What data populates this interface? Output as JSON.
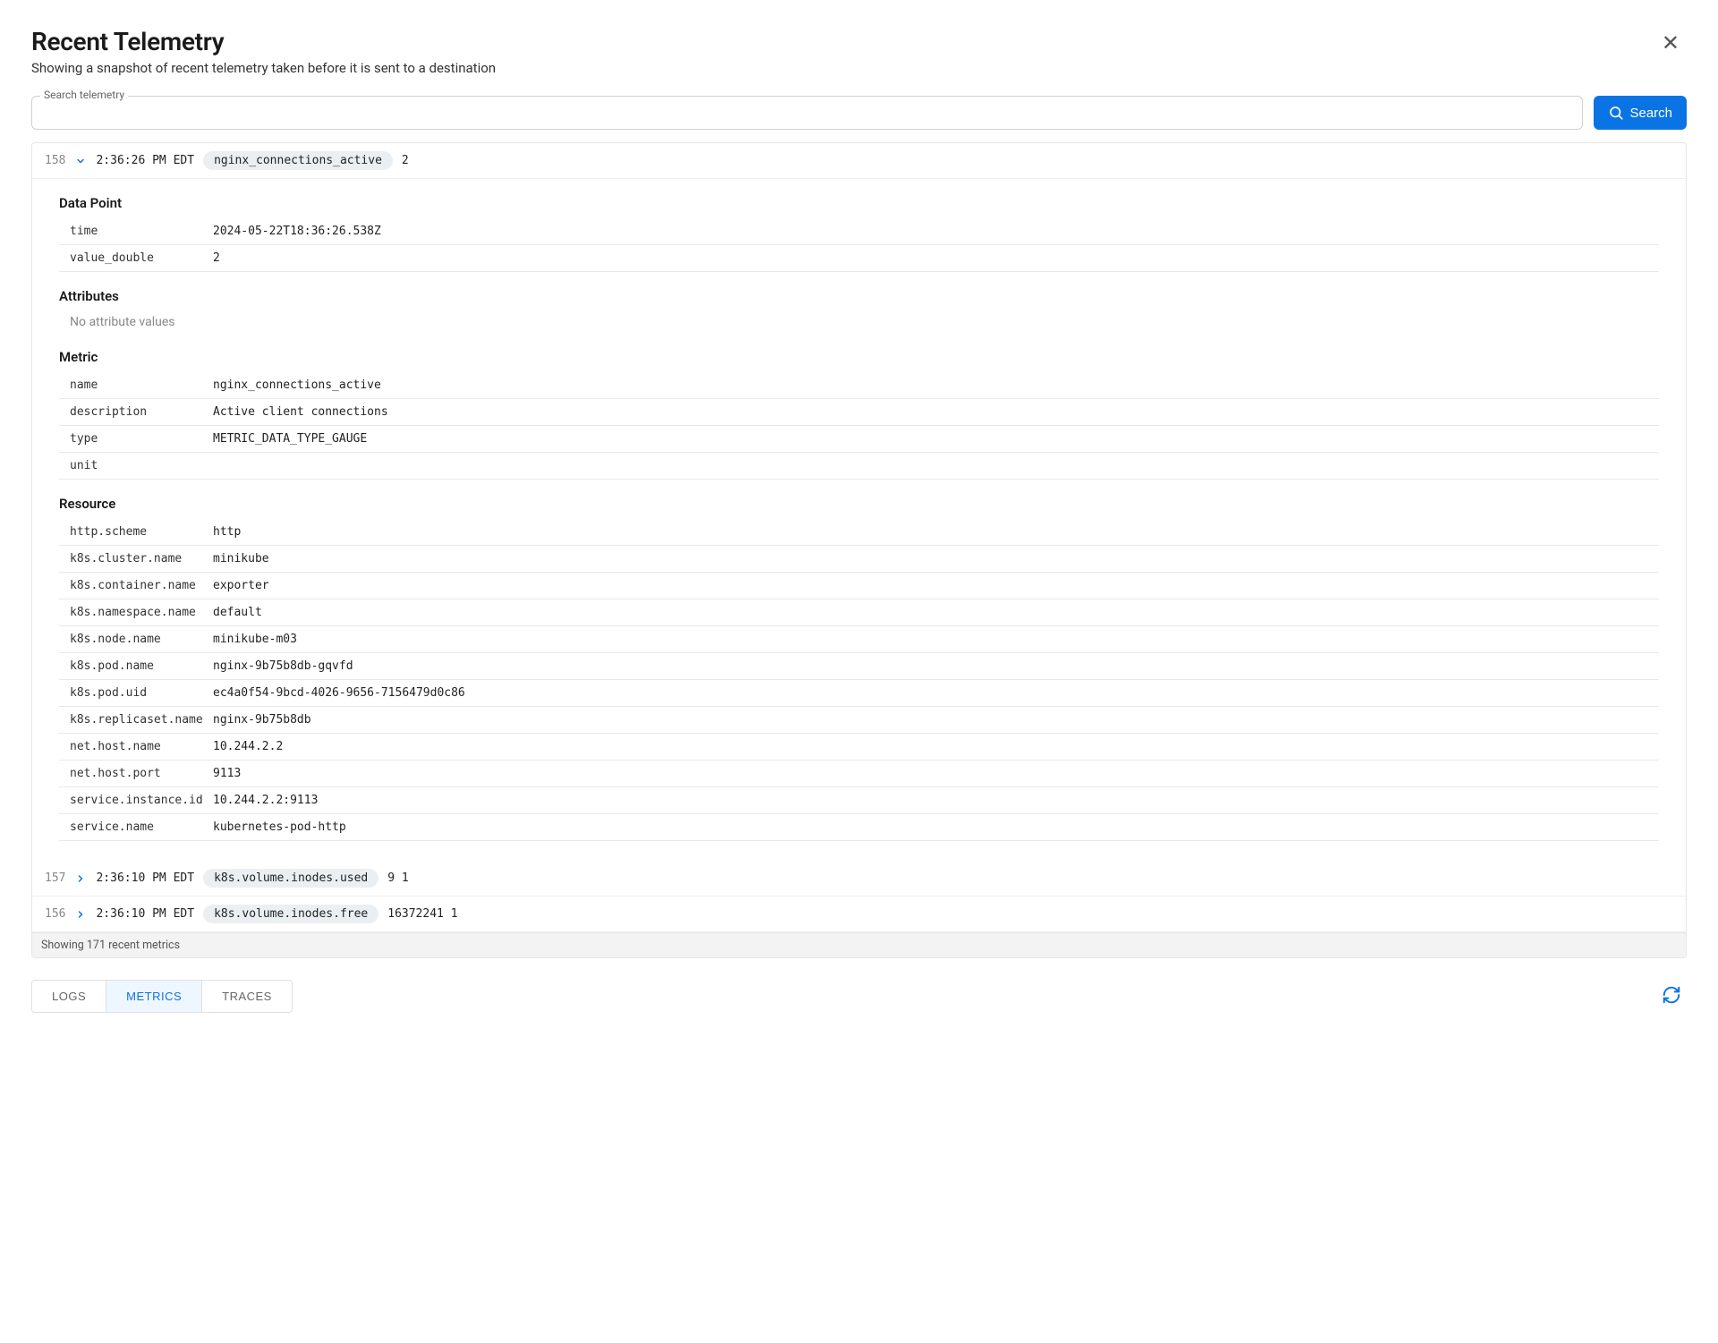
{
  "header": {
    "title": "Recent Telemetry",
    "subtitle": "Showing a snapshot of recent telemetry taken before it is sent to a destination"
  },
  "search": {
    "label": "Search telemetry",
    "placeholder": "",
    "button_label": "Search"
  },
  "expanded_entry": {
    "id": "158",
    "timestamp": "2:36:26 PM EDT",
    "metric_name": "nginx_connections_active",
    "value_short": "2",
    "sections": {
      "data_point": {
        "title": "Data Point",
        "rows": [
          {
            "key": "time",
            "val": "2024-05-22T18:36:26.538Z"
          },
          {
            "key": "value_double",
            "val": "2"
          }
        ]
      },
      "attributes": {
        "title": "Attributes",
        "empty_text": "No attribute values"
      },
      "metric": {
        "title": "Metric",
        "rows": [
          {
            "key": "name",
            "val": "nginx_connections_active"
          },
          {
            "key": "description",
            "val": "Active client connections"
          },
          {
            "key": "type",
            "val": "METRIC_DATA_TYPE_GAUGE"
          },
          {
            "key": "unit",
            "val": ""
          }
        ]
      },
      "resource": {
        "title": "Resource",
        "rows": [
          {
            "key": "http.scheme",
            "val": "http"
          },
          {
            "key": "k8s.cluster.name",
            "val": "minikube"
          },
          {
            "key": "k8s.container.name",
            "val": "exporter"
          },
          {
            "key": "k8s.namespace.name",
            "val": "default"
          },
          {
            "key": "k8s.node.name",
            "val": "minikube-m03"
          },
          {
            "key": "k8s.pod.name",
            "val": "nginx-9b75b8db-gqvfd"
          },
          {
            "key": "k8s.pod.uid",
            "val": "ec4a0f54-9bcd-4026-9656-7156479d0c86"
          },
          {
            "key": "k8s.replicaset.name",
            "val": "nginx-9b75b8db"
          },
          {
            "key": "net.host.name",
            "val": "10.244.2.2"
          },
          {
            "key": "net.host.port",
            "val": "9113"
          },
          {
            "key": "service.instance.id",
            "val": "10.244.2.2:9113"
          },
          {
            "key": "service.name",
            "val": "kubernetes-pod-http"
          }
        ]
      }
    }
  },
  "collapsed_entries": [
    {
      "id": "157",
      "timestamp": "2:36:10 PM EDT",
      "metric_name": "k8s.volume.inodes.used",
      "value_short": "9 1"
    },
    {
      "id": "156",
      "timestamp": "2:36:10 PM EDT",
      "metric_name": "k8s.volume.inodes.free",
      "value_short": "16372241 1"
    }
  ],
  "footer": {
    "summary": "Showing 171 recent metrics"
  },
  "tabs": {
    "logs": "LOGS",
    "metrics": "METRICS",
    "traces": "TRACES",
    "active": "metrics"
  }
}
